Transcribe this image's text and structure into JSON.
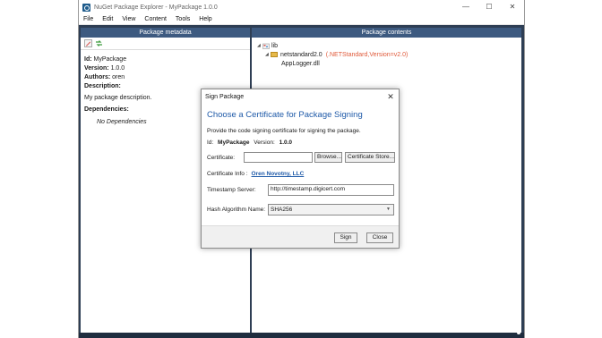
{
  "window": {
    "title": "NuGet Package Explorer - MyPackage 1.0.0",
    "controls": {
      "minimize": "—",
      "maximize": "☐",
      "close": "✕"
    }
  },
  "menu": [
    "File",
    "Edit",
    "View",
    "Content",
    "Tools",
    "Help"
  ],
  "metadata_pane": {
    "header": "Package metadata",
    "toolbar_icons": [
      "edit-icon",
      "sync-icon"
    ],
    "id_label": "Id:",
    "id_value": "MyPackage",
    "version_label": "Version:",
    "version_value": "1.0.0",
    "authors_label": "Authors:",
    "authors_value": "oren",
    "description_label": "Description:",
    "description_value": "My package description.",
    "dependencies_label": "Dependencies:",
    "no_dependencies": "No Dependencies"
  },
  "contents_pane": {
    "header": "Package contents",
    "root": "lib",
    "framework_folder": "netstandard2.0",
    "framework_target": "(.NETStandard,Version=v2.0)",
    "file": "AppLogger.dll"
  },
  "dialog": {
    "title": "Sign Package",
    "close": "✕",
    "heading": "Choose a Certificate for Package Signing",
    "instructions": "Provide the code signing certificate for signing the package.",
    "id_label": "Id:",
    "id_value": "MyPackage",
    "version_label": "Version:",
    "version_value": "1.0.0",
    "certificate_label": "Certificate:",
    "certificate_value": "",
    "browse_button": "Browse...",
    "store_button": "Certificate Store...",
    "cert_info_label": "Certificate Info :",
    "cert_info_link": "Oren Novotny, LLC",
    "timestamp_label": "Timestamp Server:",
    "timestamp_value": "http://timestamp.digicert.com",
    "hash_label": "Hash Algorithm Name:",
    "hash_value": "SHA256",
    "sign_button": "Sign",
    "close_button": "Close"
  }
}
